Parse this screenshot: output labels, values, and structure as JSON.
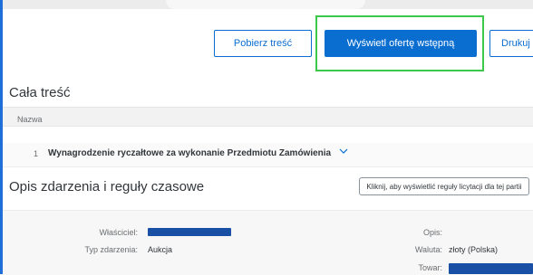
{
  "toolbar": {
    "download_label": "Pobierz treść",
    "preview_label": "Wyświetl ofertę wstępną",
    "print_label": "Drukuj"
  },
  "content": {
    "title": "Cała treść",
    "table": {
      "column_header": "Nazwa",
      "sort_indicator": "↑",
      "rows": [
        {
          "number": "1",
          "label": "Wynagrodzenie ryczałtowe za wykonanie Przedmiotu Zamówienia"
        }
      ]
    }
  },
  "event": {
    "title": "Opis zdarzenia i reguły czasowe",
    "rules_button_label": "Kliknij, aby wyświetlić reguły licytacji dla tej partii",
    "fields": {
      "owner_label": "Właściciel:",
      "type_label": "Typ zdarzenia:",
      "type_value": "Aukcja",
      "description_label": "Opis:",
      "currency_label": "Waluta:",
      "currency_value": "złoty (Polska)",
      "commodity_label": "Towar:"
    }
  },
  "colors": {
    "accent": "#0a6ed1",
    "focus_ring": "#3cc84a",
    "redaction": "#1a4fa6"
  }
}
